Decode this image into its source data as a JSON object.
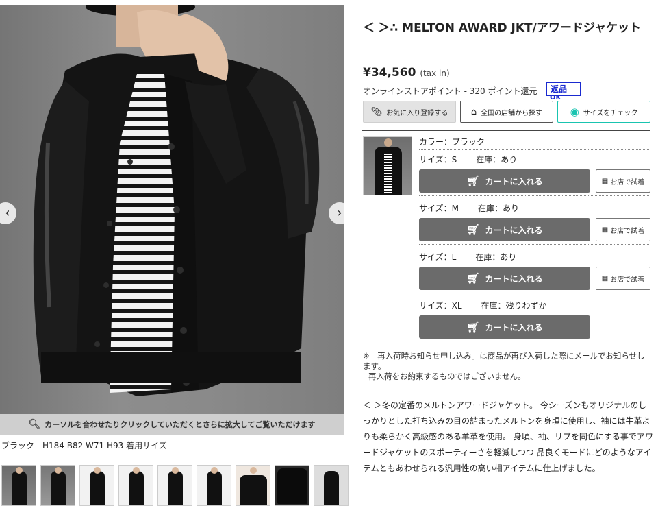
{
  "gallery": {
    "prev_label": "‹",
    "next_label": "›",
    "zoom_hint": "カーソルを合わせたりクリックしていただくとさらに拡大してご覧いただけます",
    "caption": "ブラック　H184 B82 W71 H93 着用サイズ",
    "thumb_count": 9
  },
  "product": {
    "brand_small": "",
    "title_prefix": "＜",
    "title_blurred": "               ",
    "title_mid": "＞∴ MELTON AWARD JKT/アワードジャケット",
    "price": "¥34,560",
    "tax": "(tax in)",
    "points": "オンラインストアポイント - 320 ポイント還元",
    "return_badge": "返品",
    "return_ok": "OK"
  },
  "actions": {
    "favorite": "お気に入り登録する",
    "store_search": "全国の店舗から探す",
    "size_check": "サイズをチェック"
  },
  "variants": {
    "color": "カラー：ブラック",
    "cart_label": "カートに入れる",
    "try_label": "お店で試着",
    "sizes": [
      {
        "size": "サイズ：S",
        "stock": "在庫：あり"
      },
      {
        "size": "サイズ：M",
        "stock": "在庫：あり"
      },
      {
        "size": "サイズ：L",
        "stock": "在庫：あり"
      },
      {
        "size": "サイズ：XL",
        "stock": "在庫：残りわずか"
      }
    ]
  },
  "notice": {
    "line1": "※「再入荷時お知らせ申し込み」は商品が再び入荷した際にメールでお知らせします。",
    "line2": "再入荷をお約束するものではございません。"
  },
  "description": {
    "prefix": "＜",
    "blurred": "            ",
    "text": "＞冬の定番のメルトンアワードジャケット。 今シーズンもオリジナルのしっかりとした打ち込みの目の詰まったメルトンを身頃に使用し、袖には牛革よりも柔らかく高級感のある羊革を使用。 身頃、袖、リブを同色にする事でアワードジャケットのスポーティーさを軽減しつつ 品良くモードにどのようなアイテムともあわせられる汎用性の高い相アイテムに仕上げました。"
  },
  "colors": {
    "cart_button": "#6b6b6b",
    "return_badge": "#1a2ad0",
    "size_check_accent": "#19c4b0",
    "zoom_bar": "#cfcfcf"
  },
  "icons": {
    "favorite": "paperclip-icon",
    "store": "home-icon",
    "size": "measure-icon",
    "cart": "cart-icon",
    "try": "store-icon",
    "zoom": "search-icon"
  }
}
